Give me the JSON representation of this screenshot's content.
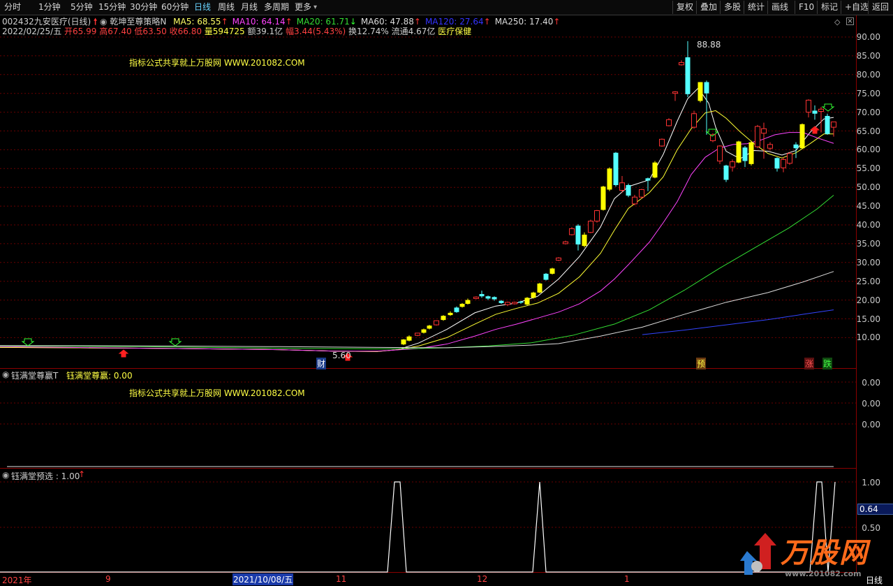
{
  "toolbar": {
    "periods": [
      "分时",
      "1分钟",
      "5分钟",
      "15分钟",
      "30分钟",
      "60分钟",
      "日线",
      "周线",
      "月线",
      "多周期",
      "更多"
    ],
    "active_period": "日线",
    "right_buttons": [
      "复权",
      "叠加",
      "多股",
      "统计",
      "画线",
      "F10",
      "标记",
      "+自选",
      "返回"
    ]
  },
  "header": {
    "code": "002432",
    "name": "九安医疗",
    "period": "(日线)",
    "indicator": "乾坤至尊策略N",
    "ma": [
      {
        "label": "MA5: 68.55",
        "color": "#ffff66",
        "dir": "up"
      },
      {
        "label": "MA10: 64.14",
        "color": "#ff44ff",
        "dir": "up"
      },
      {
        "label": "MA20: 61.71",
        "color": "#33dd33",
        "dir": "down"
      },
      {
        "label": "MA60: 47.88",
        "color": "#dddddd",
        "dir": "up"
      },
      {
        "label": "MA120: 27.64",
        "color": "#3333ff",
        "dir": "up"
      },
      {
        "label": "MA250: 17.40",
        "color": "#dddddd",
        "dir": "up"
      }
    ]
  },
  "quote": {
    "date": "2022/02/25/五",
    "open": "开65.99",
    "high": "高67.40",
    "low": "低63.50",
    "close": "收66.80",
    "volume": "量594725",
    "amount": "额39.1亿",
    "change": "幅3.44(5.43%)",
    "turnover": "换12.74%",
    "float_cap": "流通4.67亿",
    "sector": "医疗保健"
  },
  "watermark": "指标公式共享就上万股网 WWW.201082.COM",
  "main_markers": {
    "high_label": "88.88",
    "low_label": "5.60",
    "cai": "财",
    "yu": "预",
    "zhang": "涨",
    "die": "跌"
  },
  "main_y_ticks": [
    "90.00",
    "85.00",
    "80.00",
    "75.00",
    "70.00",
    "65.00",
    "60.00",
    "55.00",
    "50.00",
    "45.00",
    "40.00",
    "35.00",
    "30.00",
    "25.00",
    "20.00",
    "15.00",
    "10.00"
  ],
  "pane2": {
    "title": "钰满堂尊赢T",
    "value_label": "钰满堂尊赢: 0.00",
    "y_ticks": [
      "0.00",
      "0.00",
      "0.00"
    ]
  },
  "pane3": {
    "title": "钰满堂预选 : 1.00",
    "y_ticks": [
      "1.00",
      "0.50"
    ],
    "cursor_value": "0.64"
  },
  "x_axis": {
    "labels": [
      "2021年",
      "9",
      "2021/10/08/五",
      "11",
      "12",
      "1"
    ],
    "period_tag": "日线"
  },
  "logo": {
    "text": "万股网",
    "url": "www.201082.com"
  },
  "colors": {
    "up": "#ff3333",
    "down": "#54ffff",
    "yellow": "#ffff00",
    "border": "#8b0000"
  }
}
